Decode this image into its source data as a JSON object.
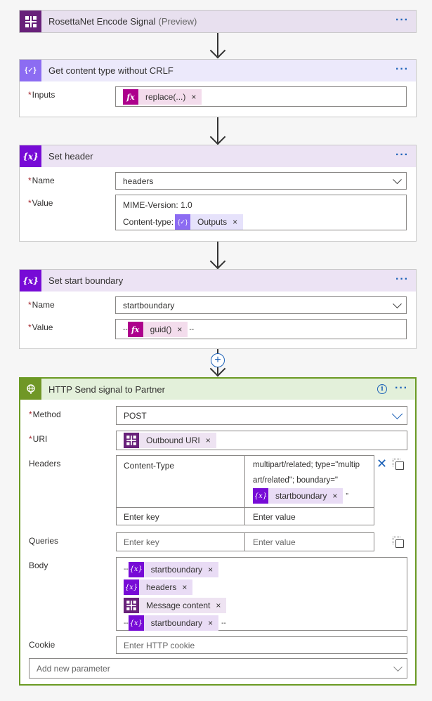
{
  "cards": {
    "rosetta": {
      "title": "RosettaNet Encode Signal",
      "preview": "(Preview)",
      "more": "···"
    },
    "compose": {
      "title": "Get content type without CRLF",
      "more": "···",
      "inputs_label": "Inputs",
      "inputs_token": {
        "label": "replace(...)",
        "icon": "fx-icon",
        "remove": "×"
      }
    },
    "set_header": {
      "title": "Set header",
      "more": "···",
      "name_label": "Name",
      "name_value": "headers",
      "value_label": "Value",
      "value_line1": "MIME-Version: 1.0",
      "value_line2_prefix": "Content-type:",
      "value_token": {
        "label": "Outputs",
        "icon": "compose-icon",
        "remove": "×"
      }
    },
    "set_start": {
      "title": "Set start boundary",
      "more": "···",
      "name_label": "Name",
      "name_value": "startboundary",
      "value_label": "Value",
      "value_prefix": "--",
      "value_token": {
        "label": "guid()",
        "icon": "fx-icon",
        "remove": "×"
      },
      "value_suffix": "--"
    },
    "http": {
      "title": "HTTP Send signal to Partner",
      "more": "···",
      "info": "i",
      "method_label": "Method",
      "method_value": "POST",
      "uri_label": "URI",
      "uri_token": {
        "label": "Outbound URI",
        "icon": "rosettanet-icon",
        "remove": "×"
      },
      "headers_label": "Headers",
      "headers_key": "Content-Type",
      "headers_value_line1": "multipart/related; type=\"multip",
      "headers_value_line2": "art/related\"; boundary=\"",
      "headers_value_token": {
        "label": "startboundary",
        "icon": "variable-icon",
        "remove": "×"
      },
      "headers_value_suffix": "\"",
      "enter_key": "Enter key",
      "enter_value": "Enter value",
      "queries_label": "Queries",
      "body_label": "Body",
      "body_lines": [
        {
          "prefix": "--",
          "token": "startboundary",
          "icon": "variable-icon",
          "suffix": ""
        },
        {
          "prefix": "",
          "token": "headers",
          "icon": "variable-icon",
          "suffix": ""
        },
        {
          "prefix": "",
          "token": "Message content",
          "icon": "rosettanet-icon",
          "suffix": ""
        },
        {
          "prefix": "--",
          "token": "startboundary",
          "icon": "variable-icon",
          "suffix": "--"
        }
      ],
      "token_remove": "×",
      "cookie_label": "Cookie",
      "cookie_placeholder": "Enter HTTP cookie",
      "add_param_placeholder": "Add new parameter"
    }
  },
  "required_mark": "*",
  "add_step": "+",
  "colors": {
    "accent": "#1d62b8",
    "rosetta": "#68217a",
    "variable": "#770bd6",
    "compose": "#8c6cf2",
    "expression": "#ad008c",
    "http": "#709727",
    "http_border": "#6a9a23"
  }
}
